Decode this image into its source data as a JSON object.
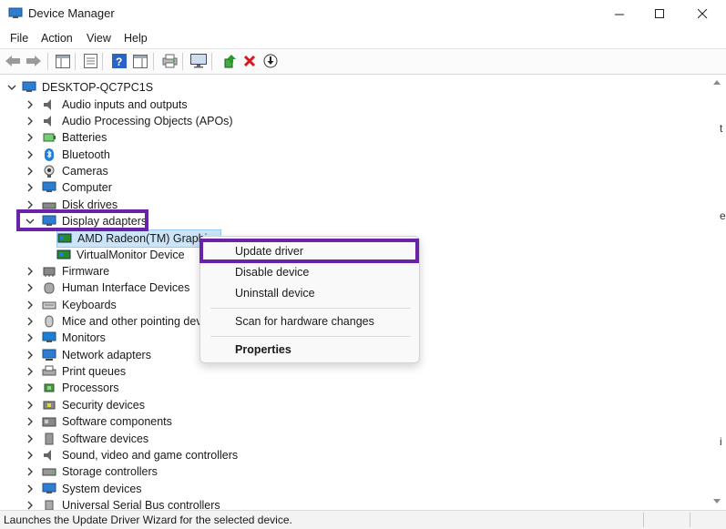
{
  "window": {
    "title": "Device Manager",
    "controls": {
      "minimize": "minimize",
      "maximize": "maximize",
      "close": "close"
    }
  },
  "menu": [
    "File",
    "Action",
    "View",
    "Help"
  ],
  "toolbar": {
    "icons": [
      "back-arrow-icon",
      "forward-arrow-icon",
      "show-hide-console-tree-icon",
      "properties-icon",
      "help-icon",
      "action-pane-icon",
      "print-icon",
      "monitor-icon",
      "update-driver-icon",
      "uninstall-icon",
      "scan-download-icon"
    ]
  },
  "tree": {
    "root": "DESKTOP-QC7PC1S",
    "categories": [
      {
        "label": "Audio inputs and outputs",
        "icon": "speaker-icon",
        "expanded": false
      },
      {
        "label": "Audio Processing Objects (APOs)",
        "icon": "speaker-icon",
        "expanded": false
      },
      {
        "label": "Batteries",
        "icon": "battery-icon",
        "expanded": false
      },
      {
        "label": "Bluetooth",
        "icon": "bluetooth-icon",
        "expanded": false
      },
      {
        "label": "Cameras",
        "icon": "camera-icon",
        "expanded": false
      },
      {
        "label": "Computer",
        "icon": "computer-icon",
        "expanded": false
      },
      {
        "label": "Disk drives",
        "icon": "disk-icon",
        "expanded": false
      },
      {
        "label": "Display adapters",
        "icon": "display-adapter-icon",
        "expanded": true,
        "children": [
          "AMD Radeon(TM) Graphics",
          "VirtualMonitor Device"
        ]
      },
      {
        "label": "Firmware",
        "icon": "firmware-icon",
        "expanded": false
      },
      {
        "label": "Human Interface Devices",
        "icon": "hid-icon",
        "expanded": false
      },
      {
        "label": "Keyboards",
        "icon": "keyboard-icon",
        "expanded": false
      },
      {
        "label": "Mice and other pointing dev",
        "icon": "mouse-icon",
        "expanded": false
      },
      {
        "label": "Monitors",
        "icon": "monitor-icon",
        "expanded": false
      },
      {
        "label": "Network adapters",
        "icon": "network-icon",
        "expanded": false
      },
      {
        "label": "Print queues",
        "icon": "printer-icon",
        "expanded": false
      },
      {
        "label": "Processors",
        "icon": "processor-icon",
        "expanded": false
      },
      {
        "label": "Security devices",
        "icon": "security-icon",
        "expanded": false
      },
      {
        "label": "Software components",
        "icon": "software-component-icon",
        "expanded": false
      },
      {
        "label": "Software devices",
        "icon": "software-device-icon",
        "expanded": false
      },
      {
        "label": "Sound, video and game controllers",
        "icon": "speaker-icon",
        "expanded": false
      },
      {
        "label": "Storage controllers",
        "icon": "storage-icon",
        "expanded": false
      },
      {
        "label": "System devices",
        "icon": "system-icon",
        "expanded": false
      },
      {
        "label": "Universal Serial Bus controllers",
        "icon": "usb-icon",
        "expanded": false
      }
    ]
  },
  "context_menu": {
    "items": [
      "Update driver",
      "Disable device",
      "Uninstall device",
      "Scan for hardware changes",
      "Properties"
    ]
  },
  "status": {
    "text": "Launches the Update Driver Wizard for the selected device."
  },
  "colors": {
    "highlight": "#6a22a8",
    "selection": "#cce4f7",
    "blue_icon": "#1e7fd6"
  }
}
